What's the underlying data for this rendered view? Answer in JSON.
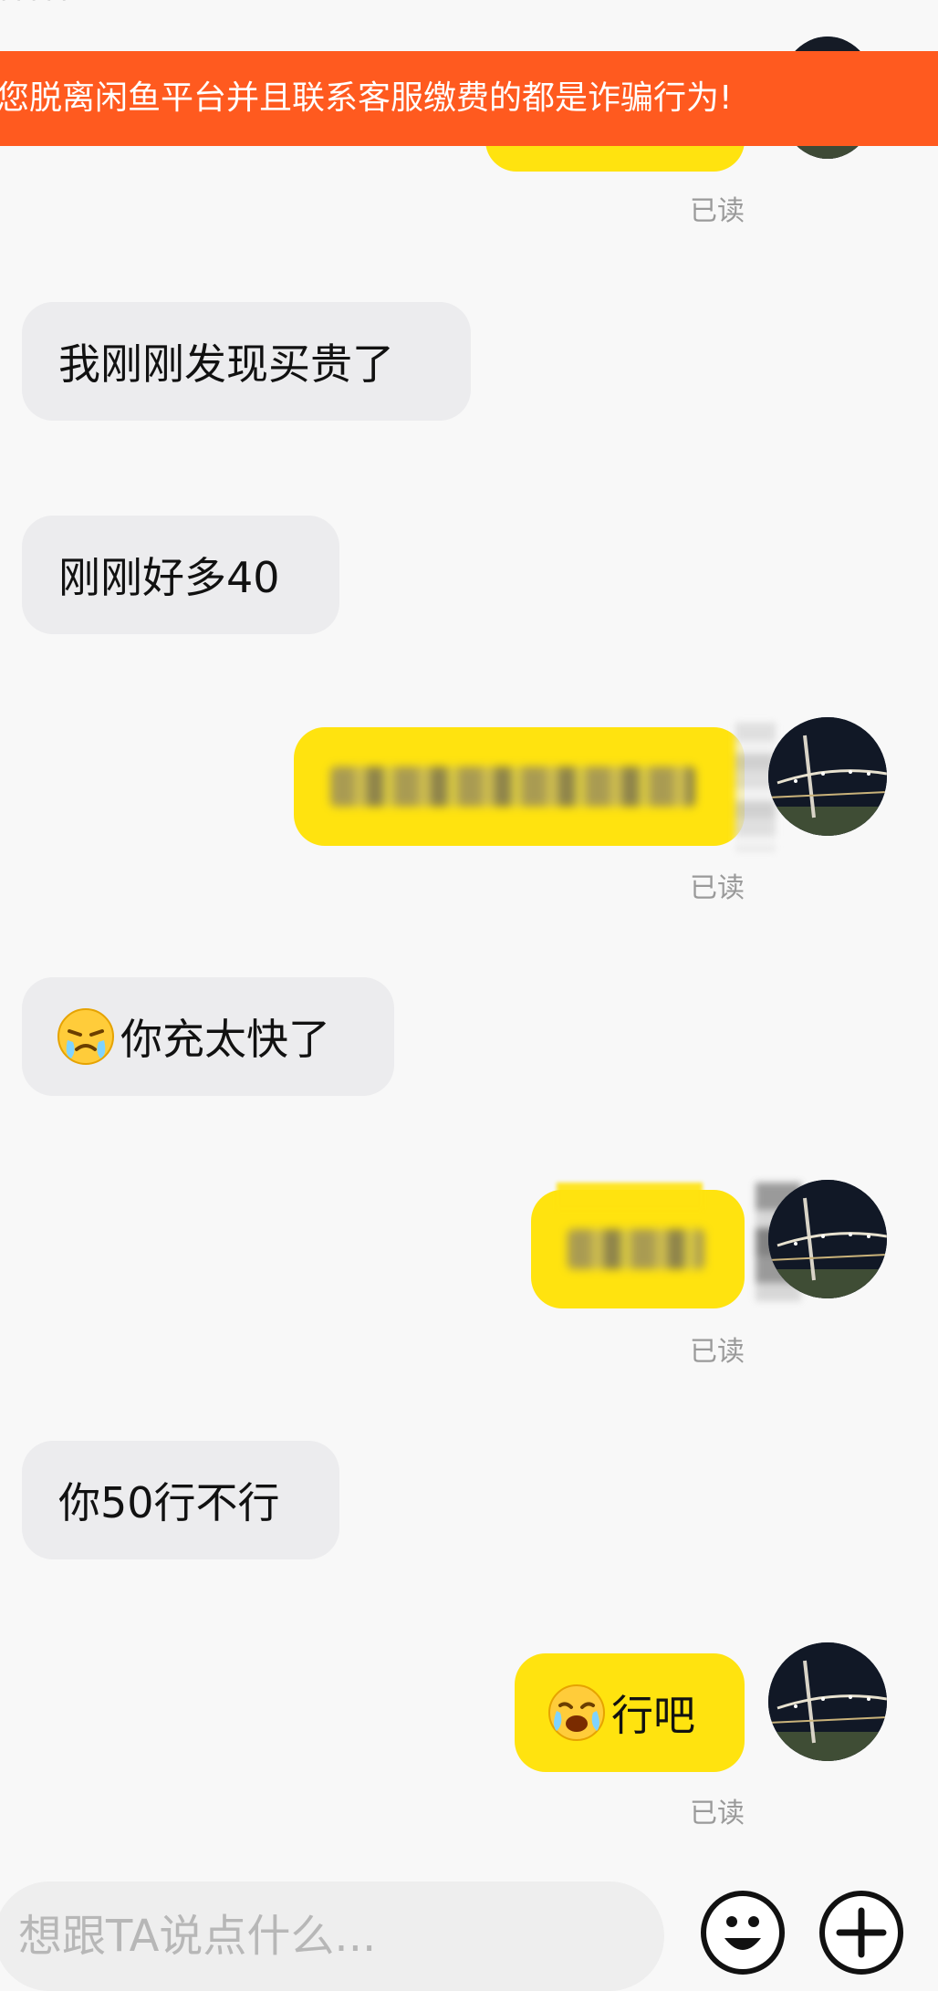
{
  "header": {
    "top_cut_text": "· · · · ·"
  },
  "banner": {
    "text": "您脱离闲鱼平台并且联系客服缴费的都是诈骗行为!"
  },
  "messages": [
    {
      "side": "incoming",
      "text": "我刚刚发现买贵了"
    },
    {
      "side": "incoming",
      "text": "刚刚好多40"
    },
    {
      "side": "outgoing",
      "text": "",
      "blurred": true,
      "read": "已读"
    },
    {
      "side": "incoming",
      "emoji": "persevering-face-icon",
      "text": "你充太快了"
    },
    {
      "side": "outgoing",
      "text": "",
      "blurred": true,
      "read": "已读"
    },
    {
      "side": "incoming",
      "text": "你50行不行"
    },
    {
      "side": "outgoing",
      "emoji": "crying-face-icon",
      "text": "行吧",
      "read": "已读"
    }
  ],
  "read_labels": {
    "first": "已读"
  },
  "input": {
    "placeholder": "想跟TA说点什么..."
  },
  "toolbar": {
    "emoji_icon": "smile-icon",
    "plus_icon": "plus-icon"
  },
  "colors": {
    "banner": "#ff5a1f",
    "outgoing_bubble": "#ffe30f",
    "incoming_bubble": "#ececee",
    "read_text": "#9a9a9a",
    "background": "#f8f8f8"
  }
}
